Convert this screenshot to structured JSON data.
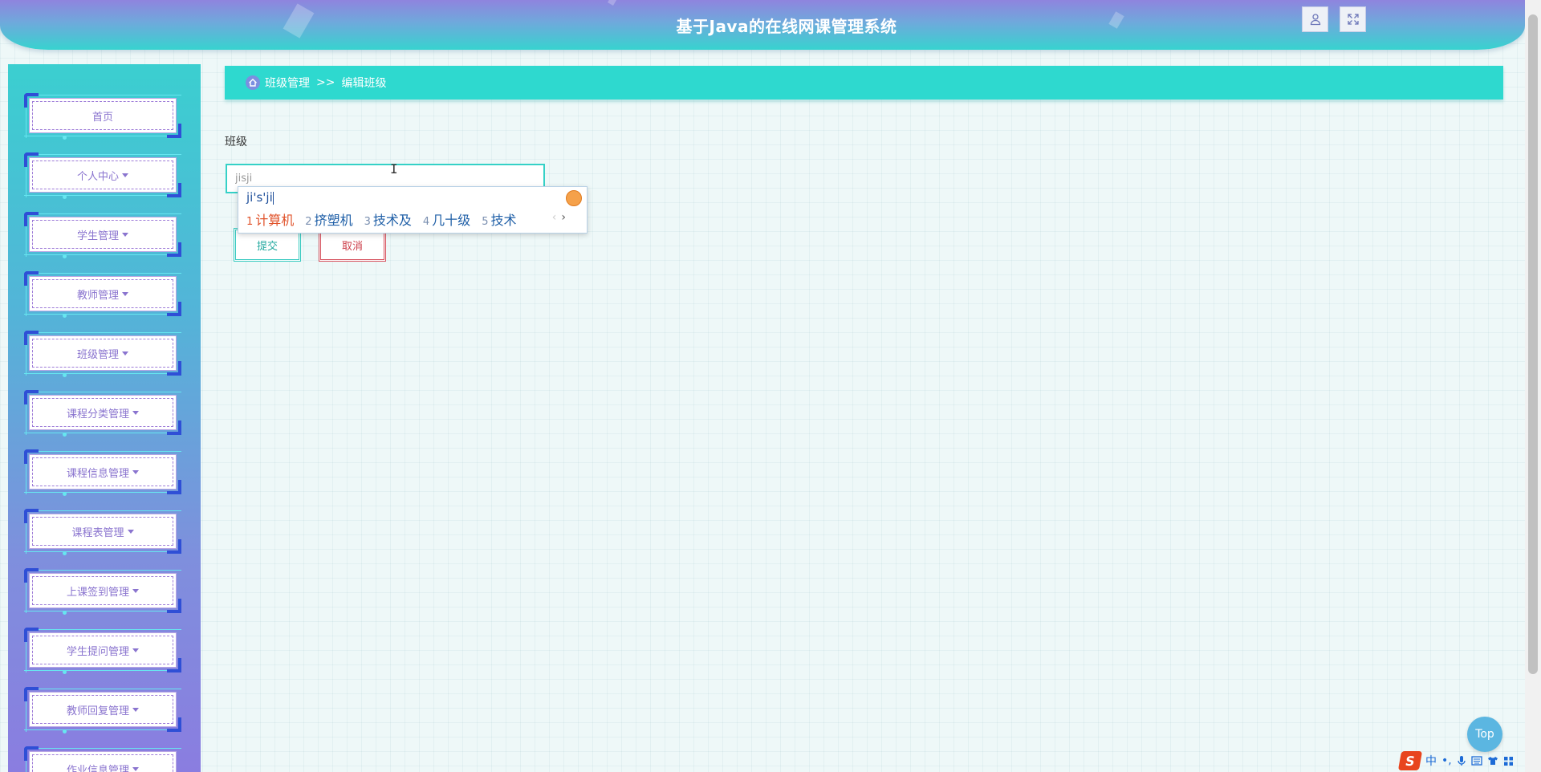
{
  "header": {
    "title": "基于Java的在线网课管理系统",
    "user_icon": "user-icon",
    "fullscreen_icon": "fullscreen-icon"
  },
  "sidebar": {
    "items": [
      {
        "label": "首页",
        "has_caret": false
      },
      {
        "label": "个人中心",
        "has_caret": true
      },
      {
        "label": "学生管理",
        "has_caret": true
      },
      {
        "label": "教师管理",
        "has_caret": true
      },
      {
        "label": "班级管理",
        "has_caret": true
      },
      {
        "label": "课程分类管理",
        "has_caret": true
      },
      {
        "label": "课程信息管理",
        "has_caret": true
      },
      {
        "label": "课程表管理",
        "has_caret": true
      },
      {
        "label": "上课签到管理",
        "has_caret": true
      },
      {
        "label": "学生提问管理",
        "has_caret": true
      },
      {
        "label": "教师回复管理",
        "has_caret": true
      },
      {
        "label": "作业信息管理",
        "has_caret": true
      }
    ]
  },
  "breadcrumb": {
    "home_icon": "home-icon",
    "parent": "班级管理",
    "separator": ">>",
    "current": "编辑班级"
  },
  "form": {
    "class_label": "班级",
    "class_value": "jisji",
    "submit_label": "提交",
    "cancel_label": "取消"
  },
  "ime_popup": {
    "composition": "ji's'ji",
    "candidates": [
      {
        "num": "1",
        "text": "计算机"
      },
      {
        "num": "2",
        "text": "挤塑机"
      },
      {
        "num": "3",
        "text": "技术及"
      },
      {
        "num": "4",
        "text": "几十级"
      },
      {
        "num": "5",
        "text": "技术"
      }
    ],
    "prev": "‹",
    "next": "›"
  },
  "top_button": {
    "label": "Top"
  },
  "ime_toolbar": {
    "logo": "S",
    "mode": "中",
    "punct": "•,"
  },
  "colors": {
    "accent": "#2ed9cf",
    "sidebar_top": "#3bcfd0",
    "sidebar_bottom": "#8a7de0",
    "menu_text": "#8a74cf",
    "submit": "#35c9bf",
    "cancel": "#d6505c"
  }
}
